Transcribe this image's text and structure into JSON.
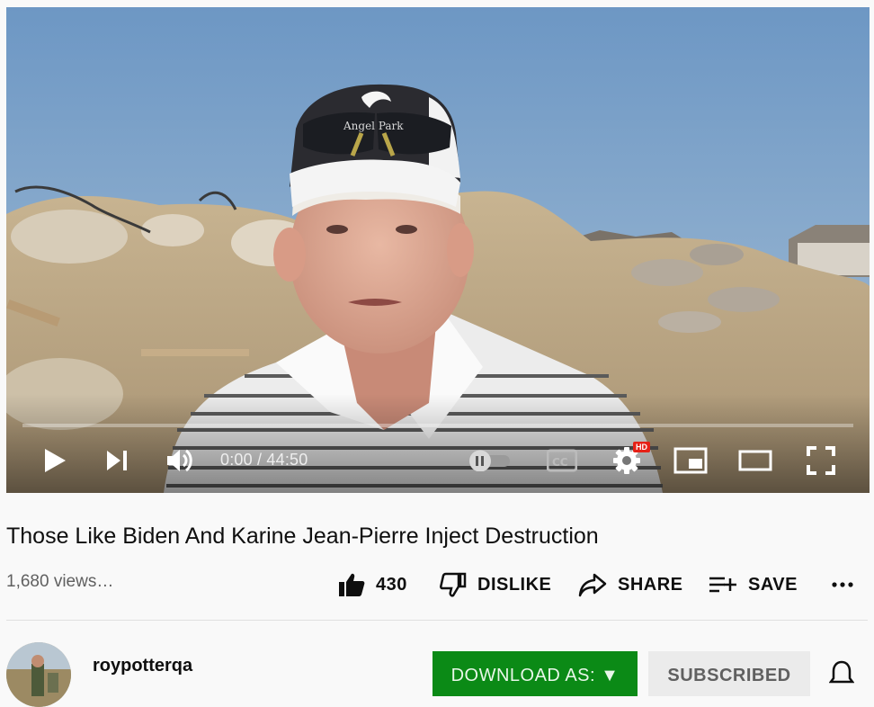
{
  "player": {
    "time_current": "0:00",
    "time_total": "44:50",
    "time_display": "0:00 / 44:50",
    "progress_fraction": 0.0,
    "quality_badge": "HD",
    "autoplay_on": true,
    "icons": {
      "play": "play-icon",
      "next": "skip-next-icon",
      "volume": "volume-icon",
      "autoplay": "autoplay-toggle-icon",
      "captions": "closed-captions-icon",
      "settings": "gear-icon",
      "miniplayer": "miniplayer-icon",
      "theater": "theater-mode-icon",
      "fullscreen": "fullscreen-icon"
    },
    "video_frame_text": "Angel Park"
  },
  "video": {
    "title": "Those Like Biden And Karine Jean-Pierre Inject Destruction",
    "views": "1,680 views…",
    "like_count": "430",
    "dislike_label": "DISLIKE",
    "share_label": "SHARE",
    "save_label": "SAVE",
    "more_icon": "more-horizontal-icon"
  },
  "channel": {
    "name": "roypotterqa",
    "download_label": "DOWNLOAD AS: ▼",
    "subscribed_label": "SUBSCRIBED",
    "bell_icon": "bell-icon"
  },
  "colors": {
    "download_green": "#0b8a16",
    "progress_red": "#ff0000",
    "hd_red": "#e62117"
  }
}
